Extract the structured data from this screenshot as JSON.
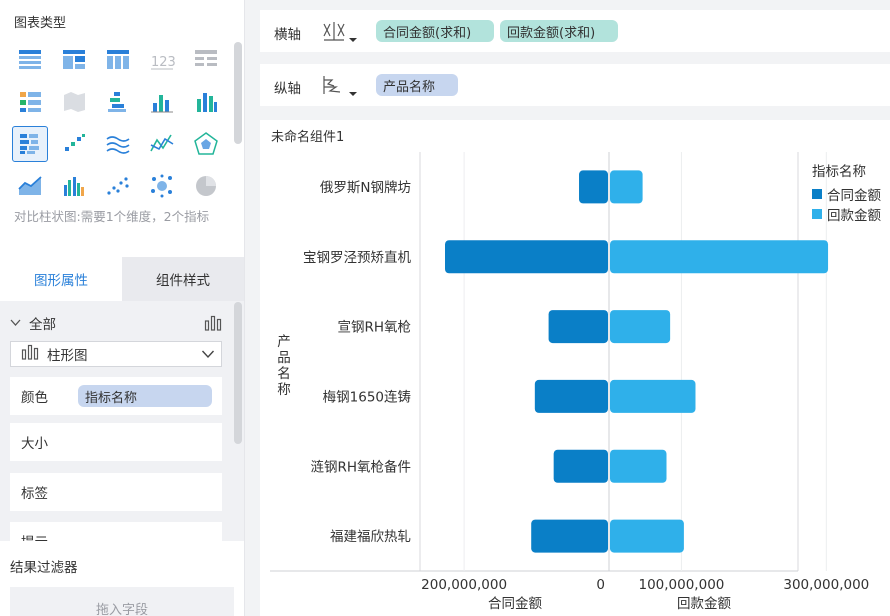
{
  "left_panel": {
    "chart_types_title": "图表类型",
    "chart_type_icons": [
      "table-icon",
      "grouped-table-icon",
      "cross-table-icon",
      "kpi-number-icon",
      "detail-table-icon",
      "filter-table-icon",
      "map-icon",
      "stacked-bar-icon",
      "bar-chart-icon",
      "column-chart-icon",
      "comparison-bar-icon",
      "range-bar-icon",
      "multi-line-icon",
      "line-area-icon",
      "radar-icon",
      "area-chart-icon",
      "grouped-column-icon",
      "scatter-icon",
      "bubble-icon",
      "pie-chart-icon"
    ],
    "selected_type_index": 10,
    "type_description": "对比柱状图:需要1个维度，2个指标",
    "tabs": [
      {
        "label": "图形属性",
        "active": true
      },
      {
        "label": "组件样式",
        "active": false
      }
    ],
    "all_label": "全部",
    "chart_type_select": "柱形图",
    "properties": {
      "color_label": "颜色",
      "color_value": "指标名称",
      "size_label": "大小",
      "label_label": "标签",
      "tooltip_label": "提示"
    },
    "filter_title": "结果过滤器",
    "filter_drop_hint": "拖入字段"
  },
  "axes": {
    "horizontal_label": "横轴",
    "horizontal_pills": [
      "合同金额(求和)",
      "回款金额(求和)"
    ],
    "vertical_label": "纵轴",
    "vertical_pills": [
      "产品名称"
    ]
  },
  "widget": {
    "title": "未命名组件1"
  },
  "colors": {
    "contract": "#0a7fc7",
    "payment": "#2fb0ea",
    "accent": "#2a80d9"
  },
  "chart_data": {
    "type": "bar",
    "ylabel": "产品名称",
    "categories": [
      "俄罗斯N钢牌坊",
      "宝钢罗泾预矫直机",
      "宣钢RH氧枪",
      "梅钢1650连铸",
      "涟钢RH氧枪备件",
      "福建福欣热轧"
    ],
    "series": [
      {
        "name": "合同金额",
        "values": [
          40000000,
          225000000,
          82000000,
          101000000,
          75000000,
          106000000
        ]
      },
      {
        "name": "回款金额",
        "values": [
          45000000,
          301000000,
          83000000,
          118000000,
          78000000,
          102000000
        ]
      }
    ],
    "left_axis": {
      "label": "合同金额",
      "ticks": [
        {
          "value": 200000000,
          "text": "200,000,000"
        },
        {
          "value": 0,
          "text": "0"
        }
      ]
    },
    "right_axis": {
      "label": "回款金额",
      "ticks": [
        {
          "value": 100000000,
          "text": "100,000,000"
        },
        {
          "value": 300000000,
          "text": "300,000,000"
        }
      ]
    },
    "legend": {
      "title": "指标名称",
      "position": "top-right"
    }
  }
}
